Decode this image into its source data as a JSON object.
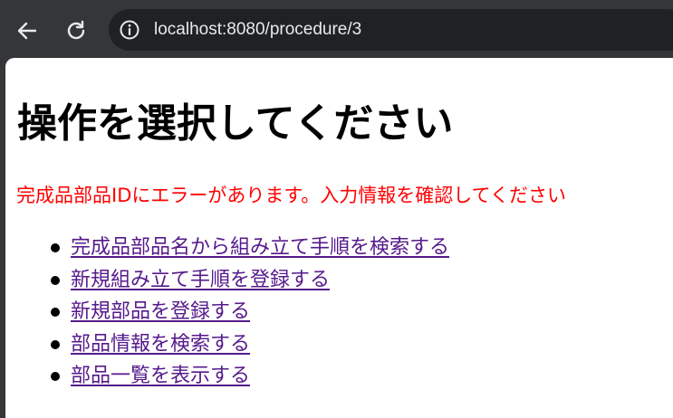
{
  "browser": {
    "url": "localhost:8080/procedure/3",
    "icons": [
      "back-arrow-icon",
      "reload-icon",
      "site-info-icon"
    ]
  },
  "page": {
    "title": "操作を選択してください",
    "error_message": "完成品部品IDにエラーがあります。入力情報を確認してください",
    "links": [
      "完成品部品名から組み立て手順を検索する",
      "新規組み立て手順を登録する",
      "新規部品を登録する",
      "部品情報を検索する",
      "部品一覧を表示する"
    ]
  },
  "colors": {
    "browser_chrome": "#35363a",
    "omnibox": "#202124",
    "error": "#ff0000",
    "visited_link": "#551a8b"
  }
}
